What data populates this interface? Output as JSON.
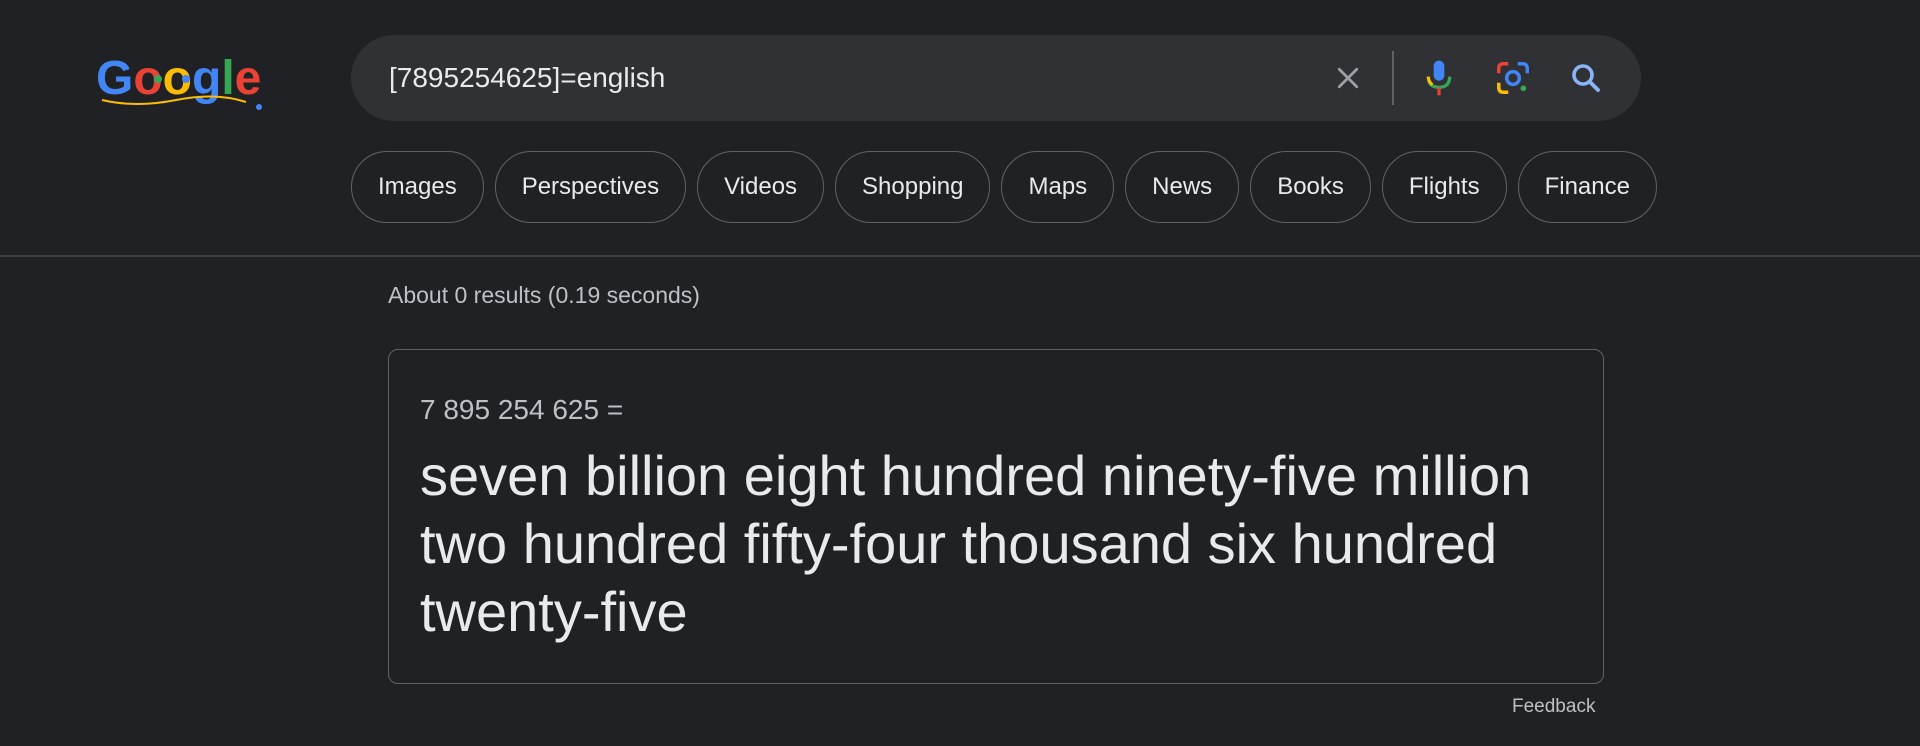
{
  "logo": {
    "text": "Google"
  },
  "search": {
    "query": "[7895254625]=english",
    "placeholder": ""
  },
  "icons": {
    "clear": "close-icon",
    "mic": "microphone-icon",
    "lens": "google-lens-icon",
    "search": "search-icon"
  },
  "tabs": [
    {
      "label": "Images"
    },
    {
      "label": "Perspectives"
    },
    {
      "label": "Videos"
    },
    {
      "label": "Shopping"
    },
    {
      "label": "Maps"
    },
    {
      "label": "News"
    },
    {
      "label": "Books"
    },
    {
      "label": "Flights"
    },
    {
      "label": "Finance"
    }
  ],
  "results": {
    "stats": "About 0 results (0.19 seconds)"
  },
  "answer_card": {
    "expression": "7 895 254 625 =",
    "answer": "seven billion eight hundred ninety-five million two hundred fifty-four thousand six hundred twenty-five"
  },
  "feedback": {
    "label": "Feedback"
  },
  "colors": {
    "background": "#202124",
    "search_bar": "#303134",
    "text_primary": "#e8eaed",
    "text_secondary": "#bdc1c6",
    "border": "#5f6368",
    "blue": "#8ab4f8",
    "google_blue": "#4285f4",
    "google_red": "#ea4335",
    "google_yellow": "#fbbc05",
    "google_green": "#34a853"
  }
}
